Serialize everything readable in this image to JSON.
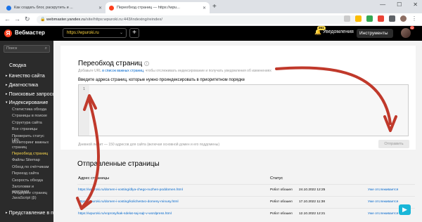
{
  "browser": {
    "tabs": [
      {
        "title": "Как создать блог, раскрутить и ...",
        "fav_color": "#1a73e8"
      },
      {
        "title": "Переобход страниц — https://wpu...",
        "fav_color": "#fc3f1d"
      }
    ],
    "newtab": "+",
    "url_host": "webmaster.yandex.ru",
    "url_path": "/site/https:wpuroki.ru:443/indexing/reindex/"
  },
  "header": {
    "app_title": "Вебмастер",
    "logo_letter": "Я",
    "site_selected": "https://wpuroki.ru",
    "add_site": "+",
    "notifications_label": "Уведомления",
    "notifications_count": "261",
    "tools_label": "Инструменты",
    "avatar_badge": "32"
  },
  "sidebar": {
    "search_placeholder": "Поиск",
    "sections": [
      {
        "label": "Сводка",
        "mode": "plain"
      },
      {
        "label": "Качество сайта",
        "mode": "arrow"
      },
      {
        "label": "Диагностика",
        "mode": "arrow"
      },
      {
        "label": "Поисковые запросы",
        "mode": "arrow"
      },
      {
        "label": "Индексирование",
        "mode": "open"
      }
    ],
    "sub_items": [
      "Статистика обхода",
      "Страницы в поиске",
      "Структура сайта",
      "Все страницы",
      "Проверить статус URL",
      "Мониторинг важных страниц",
      "Переобход страниц",
      "Файлы Sitemap",
      "Обход по счётчикам",
      "Переезд сайта",
      "Скорость обхода",
      "Заголовки и описания",
      "Рендеринг страниц JavaScript (β)"
    ],
    "active_sub": "Переобход страниц",
    "bottom_section": "Представление в поиске"
  },
  "reindex": {
    "title": "Переобход страниц",
    "desc_prefix": "Добавьте URL",
    "desc_link": "в список важных страниц",
    "desc_suffix": ", чтобы отслеживать индексирование и получать уведомления об изменениях",
    "input_label": "Введите адреса страниц, которые нужно проиндексировать в приоритетном порядке",
    "line_number": "1",
    "quota_note": "Дневной лимит — 150 адресов для сайта (включая основной домен и его поддомены)",
    "send_button": "Отправить"
  },
  "sent": {
    "title": "Отправленные страницы",
    "columns": {
      "url": "Адрес страницы",
      "status": "Статус"
    },
    "rows": [
      {
        "url": "https://wpuroki.ru/domen-i-xosting/dlya-chego-nuzhen-poddomen.html",
        "status": "Робот обошел",
        "date": "24.10.2022 12:25",
        "track": "Уже отслеживается"
      },
      {
        "url": "https://wpuroki.ru/domen-i-xosting/kolichestvo-domeny-minusy.html",
        "status": "Робот обошел",
        "date": "17.10.2022 11:38",
        "track": "Уже отслеживается"
      },
      {
        "url": "https://wpuroki.ru/voprosy/kak-sdelat-saj-sajt-v-wordpress.html",
        "status": "Робот обошел",
        "date": "12.10.2022 12:21",
        "track": "Уже отслеживается"
      }
    ]
  },
  "overlay": {
    "arrow_color": "#c0392b",
    "float_icon": "play-icon"
  }
}
